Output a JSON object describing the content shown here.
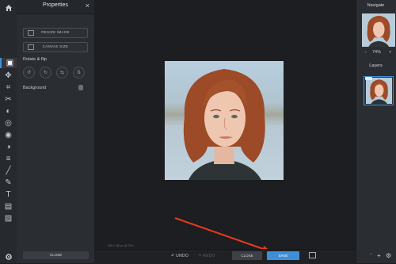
{
  "toolbar": {
    "home_icon": "home-icon",
    "settings_icon": "gear-icon",
    "tools": [
      {
        "name": "resize-tool",
        "glyph": "▣",
        "active": true
      },
      {
        "name": "move-tool",
        "glyph": "✥"
      },
      {
        "name": "crop-tool",
        "glyph": "⌗"
      },
      {
        "name": "cut-tool",
        "glyph": "✂"
      },
      {
        "name": "adjust-tool",
        "glyph": "◐"
      },
      {
        "name": "filter-tool",
        "glyph": "◎"
      },
      {
        "name": "frame-tool",
        "glyph": "◉"
      },
      {
        "name": "texture-tool",
        "glyph": "◑"
      },
      {
        "name": "lines-tool",
        "glyph": "≡"
      },
      {
        "name": "draw-tool",
        "glyph": "╱"
      },
      {
        "name": "brush-tool",
        "glyph": "✎"
      },
      {
        "name": "text-tool",
        "glyph": "T"
      },
      {
        "name": "sticker-tool",
        "glyph": "▤"
      },
      {
        "name": "image-tool",
        "glyph": "▨"
      }
    ]
  },
  "properties": {
    "title": "Properties",
    "close_glyph": "×",
    "resize_image": "RESIZE IMAGE",
    "canvas_size": "CANVAS SIZE",
    "rotate_flip": "Rotate & flip",
    "rotate_buttons": [
      "↺",
      "↻",
      "⇆",
      "⇅"
    ],
    "background": "Background",
    "close_button": "CLOSE"
  },
  "canvas": {
    "dimensions": "150 x 150 px @ 74%"
  },
  "bottombar": {
    "undo": "↶ UNDO",
    "redo": "↷ REDO",
    "close": "CLOSE",
    "save": "SAVE"
  },
  "navigate": {
    "title": "Navigate",
    "zoom_minus": "−",
    "zoom_value": "74%",
    "zoom_plus": "+"
  },
  "layers": {
    "title": "Layers",
    "add_glyph": "+"
  },
  "colors": {
    "accent": "#3f8fd8",
    "arrow": "#e8391d"
  }
}
